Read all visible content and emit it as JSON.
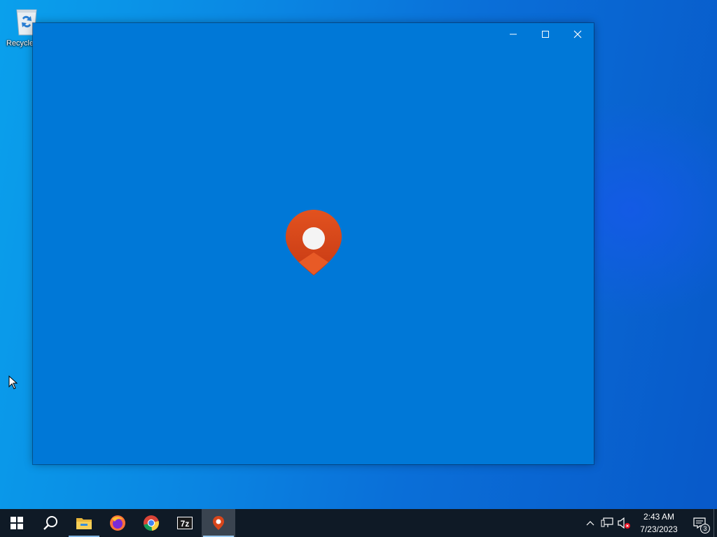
{
  "desktop": {
    "icons": [
      {
        "label": "Recycle",
        "icon": "recycle-bin-icon"
      }
    ]
  },
  "window": {
    "splash_icon": "map-pin-person-icon",
    "controls": {
      "minimize": "minimize-icon",
      "maximize": "maximize-icon",
      "close": "close-icon"
    },
    "colors": {
      "background": "#0078d7",
      "logo": "#d8461b"
    }
  },
  "taskbar": {
    "apps": [
      {
        "name": "start",
        "icon": "windows-logo-icon"
      },
      {
        "name": "search",
        "icon": "search-icon"
      },
      {
        "name": "file-explorer",
        "icon": "folder-icon"
      },
      {
        "name": "firefox",
        "icon": "firefox-icon"
      },
      {
        "name": "chrome",
        "icon": "chrome-icon"
      },
      {
        "name": "7zip",
        "icon": "7zip-icon",
        "label": "7z"
      },
      {
        "name": "maps",
        "icon": "map-pin-icon",
        "active": true
      }
    ],
    "tray": {
      "icons": [
        "chevron-up-icon",
        "network-icon",
        "volume-muted-icon"
      ],
      "time": "2:43 AM",
      "date": "7/23/2023",
      "notification_count": "3"
    }
  }
}
